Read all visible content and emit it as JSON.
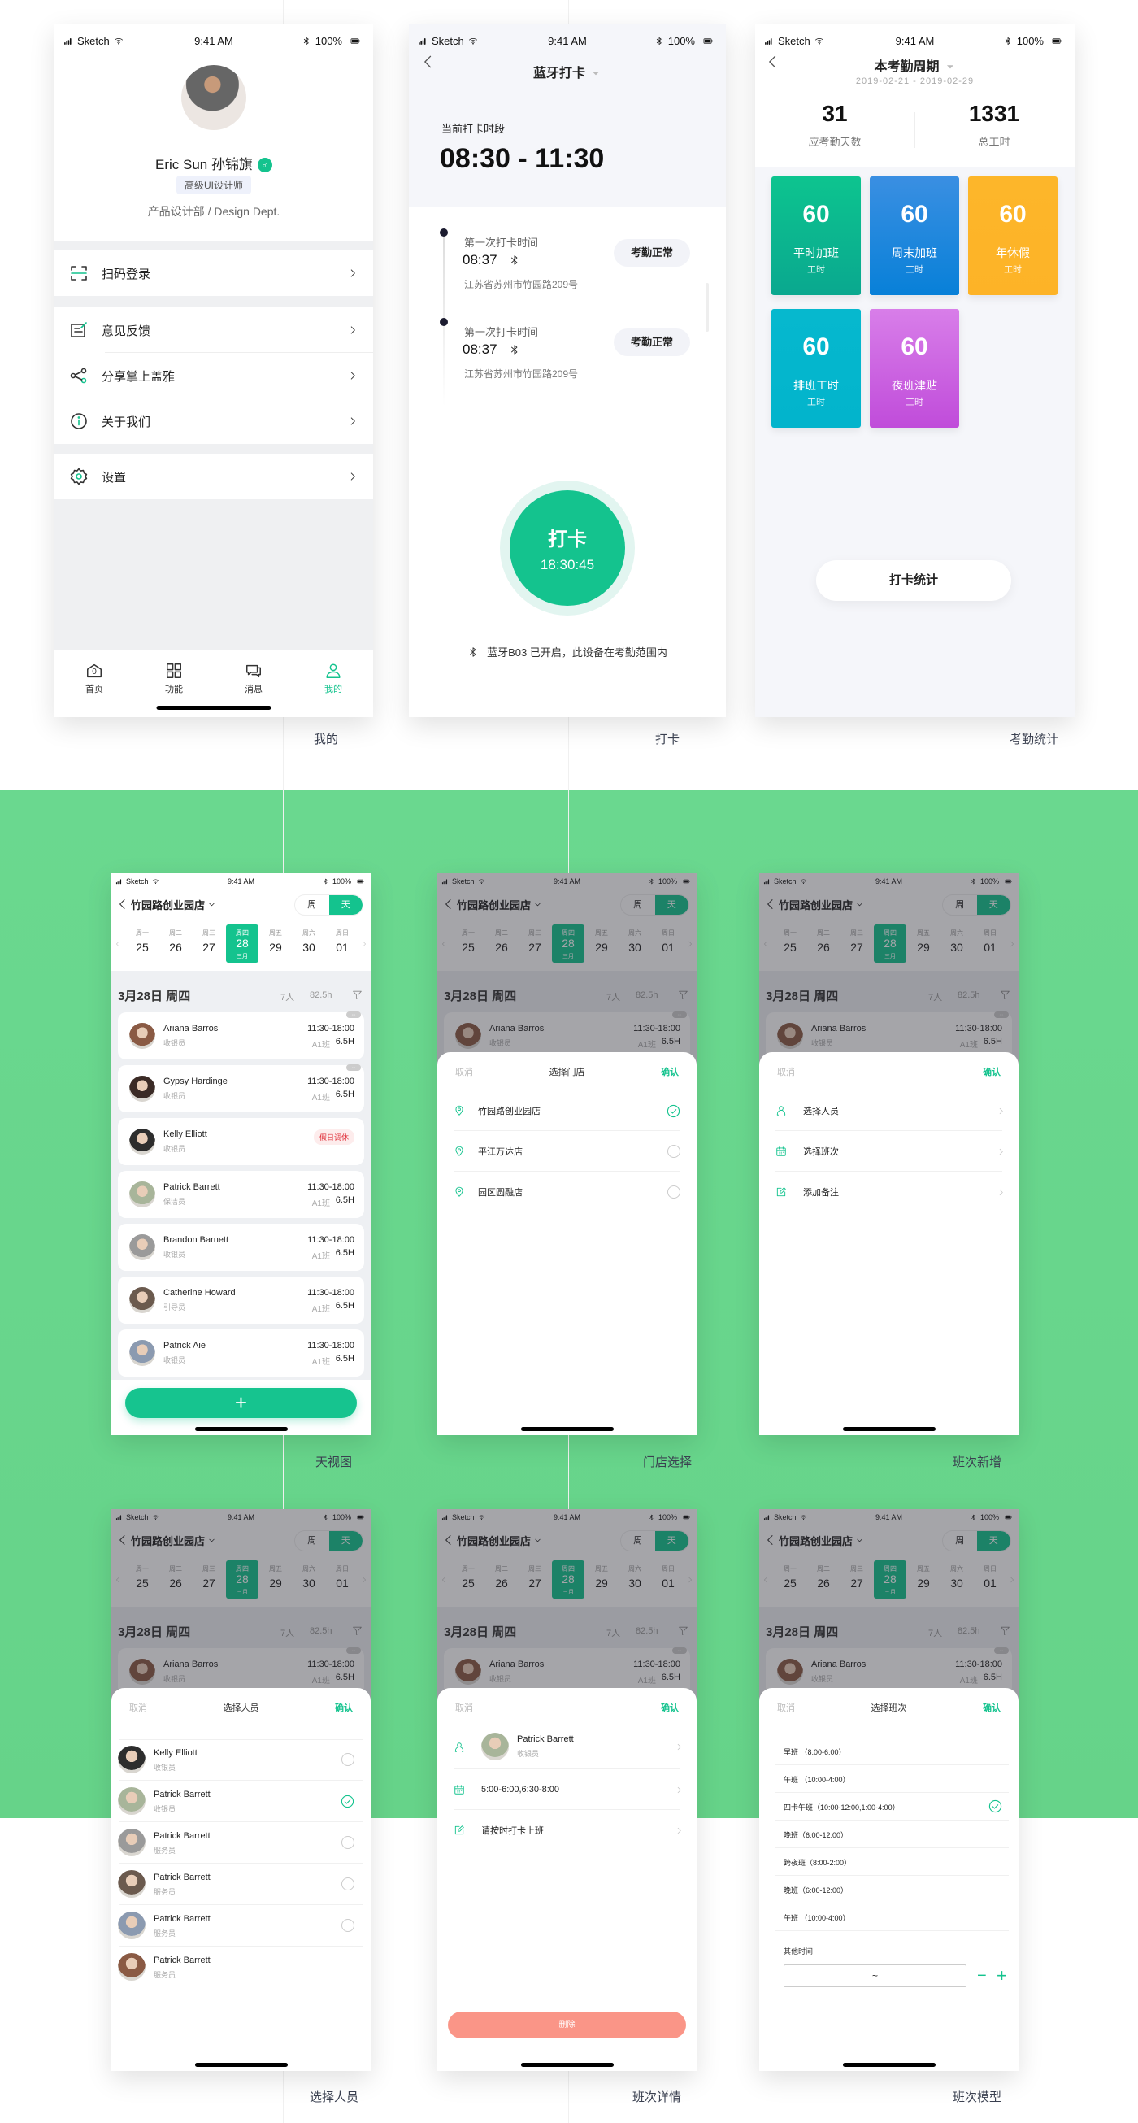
{
  "status_bar": {
    "carrier": "Sketch",
    "time": "9:41 AM",
    "battery": "100%"
  },
  "colors": {
    "brand": "#14C38E",
    "background_band": "#68D68C",
    "danger": "#FA9587",
    "holiday_tag": "#E0303A"
  },
  "profile": {
    "caption": "我的",
    "name": "Eric Sun 孙锦旗",
    "gender_icon": "male-icon",
    "title_badge": "高级UI设计师",
    "department": "产品设计部 / Design Dept.",
    "menu_groups": [
      [
        {
          "label": "扫码登录",
          "icon": "scan-icon"
        }
      ],
      [
        {
          "label": "意见反馈",
          "icon": "feedback-icon"
        },
        {
          "label": "分享掌上盖雅",
          "icon": "share-icon"
        },
        {
          "label": "关于我们",
          "icon": "info-icon"
        }
      ],
      [
        {
          "label": "设置",
          "icon": "gear-icon"
        }
      ]
    ],
    "tabs": [
      {
        "label": "首页",
        "icon": "home-icon",
        "badge": "0"
      },
      {
        "label": "功能",
        "icon": "grid-icon"
      },
      {
        "label": "消息",
        "icon": "chat-icon"
      },
      {
        "label": "我的",
        "icon": "user-icon",
        "active": true
      }
    ]
  },
  "punch": {
    "caption": "打卡",
    "title": "蓝牙打卡",
    "period_label": "当前打卡时段",
    "period": "08:30 - 11:30",
    "records": [
      {
        "label": "第一次打卡时间",
        "time": "08:37",
        "address": "江苏省苏州市竹园路209号",
        "status": "考勤正常"
      },
      {
        "label": "第一次打卡时间",
        "time": "08:37",
        "address": "江苏省苏州市竹园路209号",
        "status": "考勤正常"
      }
    ],
    "button_label": "打卡",
    "button_time": "18:30:45",
    "bluetooth_message": "蓝牙B03 已开启，此设备在考勤范围内"
  },
  "stats": {
    "caption": "考勤统计",
    "title": "本考勤周期",
    "date_range": "2019-02-21 - 2019-02-29",
    "summary": [
      {
        "value": "31",
        "label": "应考勤天数"
      },
      {
        "value": "1331",
        "label": "总工时"
      }
    ],
    "tiles": [
      {
        "value": "60",
        "label": "平时加班",
        "unit": "工时",
        "colors": [
          "#0DC48F",
          "#0AA88F"
        ]
      },
      {
        "value": "60",
        "label": "周末加班",
        "unit": "工时",
        "colors": [
          "#3A8FE2",
          "#0880D8"
        ]
      },
      {
        "value": "60",
        "label": "年休假",
        "unit": "工时",
        "colors": [
          "#FDB62A",
          "#FDB327"
        ]
      },
      {
        "value": "60",
        "label": "排班工时",
        "unit": "工时",
        "colors": [
          "#06B8CE",
          "#02B4CC"
        ]
      },
      {
        "value": "60",
        "label": "夜班津贴",
        "unit": "工时",
        "colors": [
          "#D87EE9",
          "#C04CDA"
        ]
      }
    ],
    "button": "打卡统计"
  },
  "schedule": {
    "caption": "天视图",
    "store": "竹园路创业园店",
    "view_toggle": [
      {
        "label": "周"
      },
      {
        "label": "天",
        "active": true
      }
    ],
    "week": [
      {
        "dow": "周一",
        "day": "25"
      },
      {
        "dow": "周二",
        "day": "26"
      },
      {
        "dow": "周三",
        "day": "27"
      },
      {
        "dow": "周四",
        "day": "28",
        "selected": true
      },
      {
        "dow": "周五",
        "day": "29"
      },
      {
        "dow": "周六",
        "day": "30"
      },
      {
        "dow": "周日",
        "day": "01"
      }
    ],
    "selected_month": "三月",
    "date_title": "3月28日 周四",
    "headcount": "7人",
    "total_hours": "82.5h",
    "staff": [
      {
        "name": "Ariana Barros",
        "role": "收银员",
        "time": "11:30-18:00",
        "shift": "A1班",
        "hours": "6.5H",
        "more": true
      },
      {
        "name": "Gypsy Hardinge",
        "role": "收银员",
        "time": "11:30-18:00",
        "shift": "A1班",
        "hours": "6.5H",
        "more": true
      },
      {
        "name": "Kelly Elliott",
        "role": "收银员",
        "tag": "假日调休"
      },
      {
        "name": "Patrick Barrett",
        "role": "保洁员",
        "time": "11:30-18:00",
        "shift": "A1班",
        "hours": "6.5H"
      },
      {
        "name": "Brandon Barnett",
        "role": "收银员",
        "time": "11:30-18:00",
        "shift": "A1班",
        "hours": "6.5H"
      },
      {
        "name": "Catherine Howard",
        "role": "引导员",
        "time": "11:30-18:00",
        "shift": "A1班",
        "hours": "6.5H"
      },
      {
        "name": "Patrick Aie",
        "role": "收银员",
        "time": "11:30-18:00",
        "shift": "A1班",
        "hours": "6.5H"
      }
    ],
    "add_button": "+"
  },
  "store_picker": {
    "caption": "门店选择",
    "cancel": "取消",
    "title": "选择门店",
    "confirm": "确认",
    "stores": [
      {
        "name": "竹园路创业园店",
        "selected": true
      },
      {
        "name": "平江万达店"
      },
      {
        "name": "园区圆融店"
      }
    ]
  },
  "add_shift": {
    "caption": "班次新增",
    "cancel": "取消",
    "confirm": "确认",
    "items": [
      {
        "label": "选择人员",
        "icon": "person-icon"
      },
      {
        "label": "选择班次",
        "icon": "calendar-icon"
      },
      {
        "label": "添加备注",
        "icon": "edit-icon"
      }
    ]
  },
  "person_picker": {
    "caption": "选择人员",
    "cancel": "取消",
    "title": "选择人员",
    "confirm": "确认",
    "people": [
      {
        "name": "Kelly Elliott",
        "role": "收银员"
      },
      {
        "name": "Patrick Barrett",
        "role": "收银员",
        "selected": true
      },
      {
        "name": "Patrick Barrett",
        "role": "服务员"
      },
      {
        "name": "Patrick Barrett",
        "role": "服务员"
      },
      {
        "name": "Patrick Barrett",
        "role": "服务员"
      },
      {
        "name": "Patrick Barrett",
        "role": "服务员"
      }
    ]
  },
  "shift_detail": {
    "caption": "班次详情",
    "cancel": "取消",
    "confirm": "确认",
    "person": {
      "name": "Patrick Barrett",
      "role": "收银员"
    },
    "time": "5:00-6:00,6:30-8:00",
    "note": "请按时打卡上班",
    "delete": "删除"
  },
  "shift_model": {
    "caption": "班次模型",
    "cancel": "取消",
    "title": "选择班次",
    "confirm": "确认",
    "shifts": [
      {
        "label": "早班 （8:00-6:00）"
      },
      {
        "label": "午班 （10:00-4:00）"
      },
      {
        "label": "四卡午班（10:00-12:00,1:00-4:00）",
        "selected": true
      },
      {
        "label": "晚班（6:00-12:00）"
      },
      {
        "label": "跨夜班（8:00-2:00）"
      },
      {
        "label": "晚班（6:00-12:00）"
      },
      {
        "label": "午班 （10:00-4:00）"
      }
    ],
    "other_label": "其他时间",
    "range_separator": "~"
  }
}
